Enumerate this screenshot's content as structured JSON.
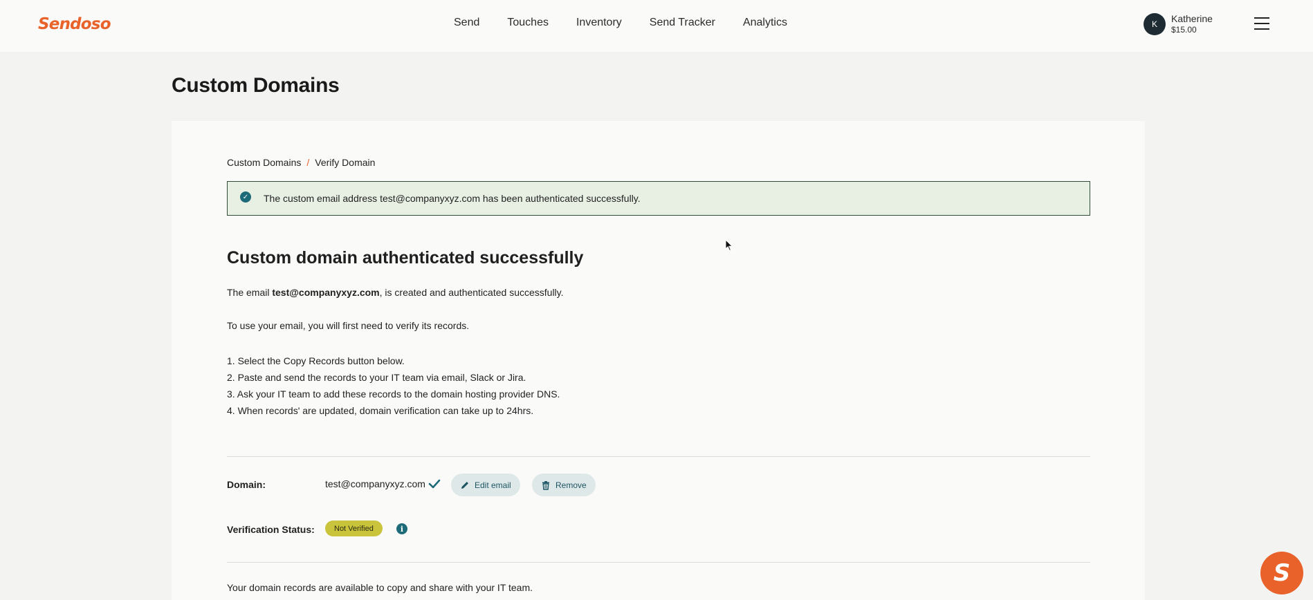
{
  "header": {
    "logo": "Sendoso",
    "nav": [
      "Send",
      "Touches",
      "Inventory",
      "Send Tracker",
      "Analytics"
    ],
    "user": {
      "initial": "K",
      "name": "Katherine",
      "balance": "$15.00"
    }
  },
  "page": {
    "title": "Custom Domains"
  },
  "breadcrumb": {
    "parent": "Custom Domains",
    "separator": "/",
    "current": "Verify Domain"
  },
  "alert": {
    "text": "The custom email address test@companyxyz.com has been authenticated successfully."
  },
  "content": {
    "heading": "Custom domain authenticated successfully",
    "intro_prefix": "The email ",
    "intro_email": "test@companyxyz.com",
    "intro_suffix": ", is created and authenticated successfully.",
    "verify_text": "To use your email, you will first need to verify its records.",
    "steps": [
      "1. Select the Copy Records button below.",
      "2. Paste and send the records to your IT team via email, Slack or Jira.",
      "3. Ask your IT team to add these records to the domain hosting provider DNS.",
      "4. When records' are updated, domain verification can take up to 24hrs."
    ]
  },
  "domain": {
    "label": "Domain:",
    "value": "test@companyxyz.com",
    "edit_label": "Edit email",
    "remove_label": "Remove"
  },
  "verification": {
    "label": "Verification Status:",
    "status": "Not Verified",
    "info": "i"
  },
  "records_text": "Your domain records are available to copy and share with your IT team.",
  "colors": {
    "brand": "#e8622a",
    "teal": "#1d6a78",
    "status_badge": "#c9c43b"
  }
}
